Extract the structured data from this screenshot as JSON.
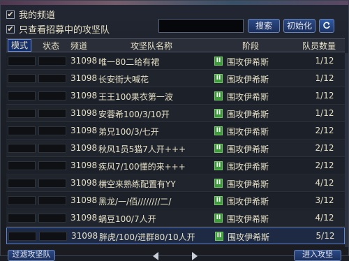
{
  "filters": {
    "my_channel_label": "我的频道",
    "recruiting_only_label": "只查看招募中的攻坚队"
  },
  "search": {
    "value": "",
    "button_label": "搜索"
  },
  "init_label": "初始化",
  "columns": [
    "模式",
    "状态",
    "频道",
    "攻坚队名称",
    "阶段",
    "队员数量"
  ],
  "rows": [
    {
      "channel": "31098",
      "team": "唯一80二给有裙",
      "stage": "围攻伊希斯",
      "members": "1/12"
    },
    {
      "channel": "31098",
      "team": "长安街大喊花",
      "stage": "围攻伊希斯",
      "members": "1/12"
    },
    {
      "channel": "31098",
      "team": "王王100果衣第一波",
      "stage": "围攻伊希斯",
      "members": "1/12"
    },
    {
      "channel": "31098",
      "team": "安蓉希100/3/10开",
      "stage": "围攻伊希斯",
      "members": "1/12"
    },
    {
      "channel": "31098",
      "team": "弟兄100/3/七开",
      "stage": "围攻伊希斯",
      "members": "2/12"
    },
    {
      "channel": "31098",
      "team": "秋风1员5猫7人开+++",
      "stage": "围攻伊希斯",
      "members": "2/12"
    },
    {
      "channel": "31098",
      "team": "疾风7/100懂的来+++",
      "stage": "围攻伊希斯",
      "members": "2/12"
    },
    {
      "channel": "31098",
      "team": "横空来熟练配置有YY",
      "stage": "围攻伊希斯",
      "members": "4/12"
    },
    {
      "channel": "31098",
      "team": "黑龙/一/佰////////二/",
      "stage": "围攻伊希斯",
      "members": "3/12"
    },
    {
      "channel": "31098",
      "team": "蜗豆100/7人开",
      "stage": "围攻伊希斯",
      "members": "4/12"
    },
    {
      "channel": "31098",
      "team": "胖虎/100/进群80/10人开",
      "stage": "围攻伊希斯",
      "members": "5/12"
    }
  ],
  "bottom": {
    "left_label": "过滤攻坚队",
    "right_label": "进入攻坚"
  },
  "icons": {
    "refresh": "refresh-icon",
    "check": "checkmark-icon",
    "tag": "stage-tag-icon"
  },
  "colors": {
    "selected_border": "#5f86cf",
    "tag_green": "#3f9c3c",
    "button_blue": "#2c4a86"
  }
}
